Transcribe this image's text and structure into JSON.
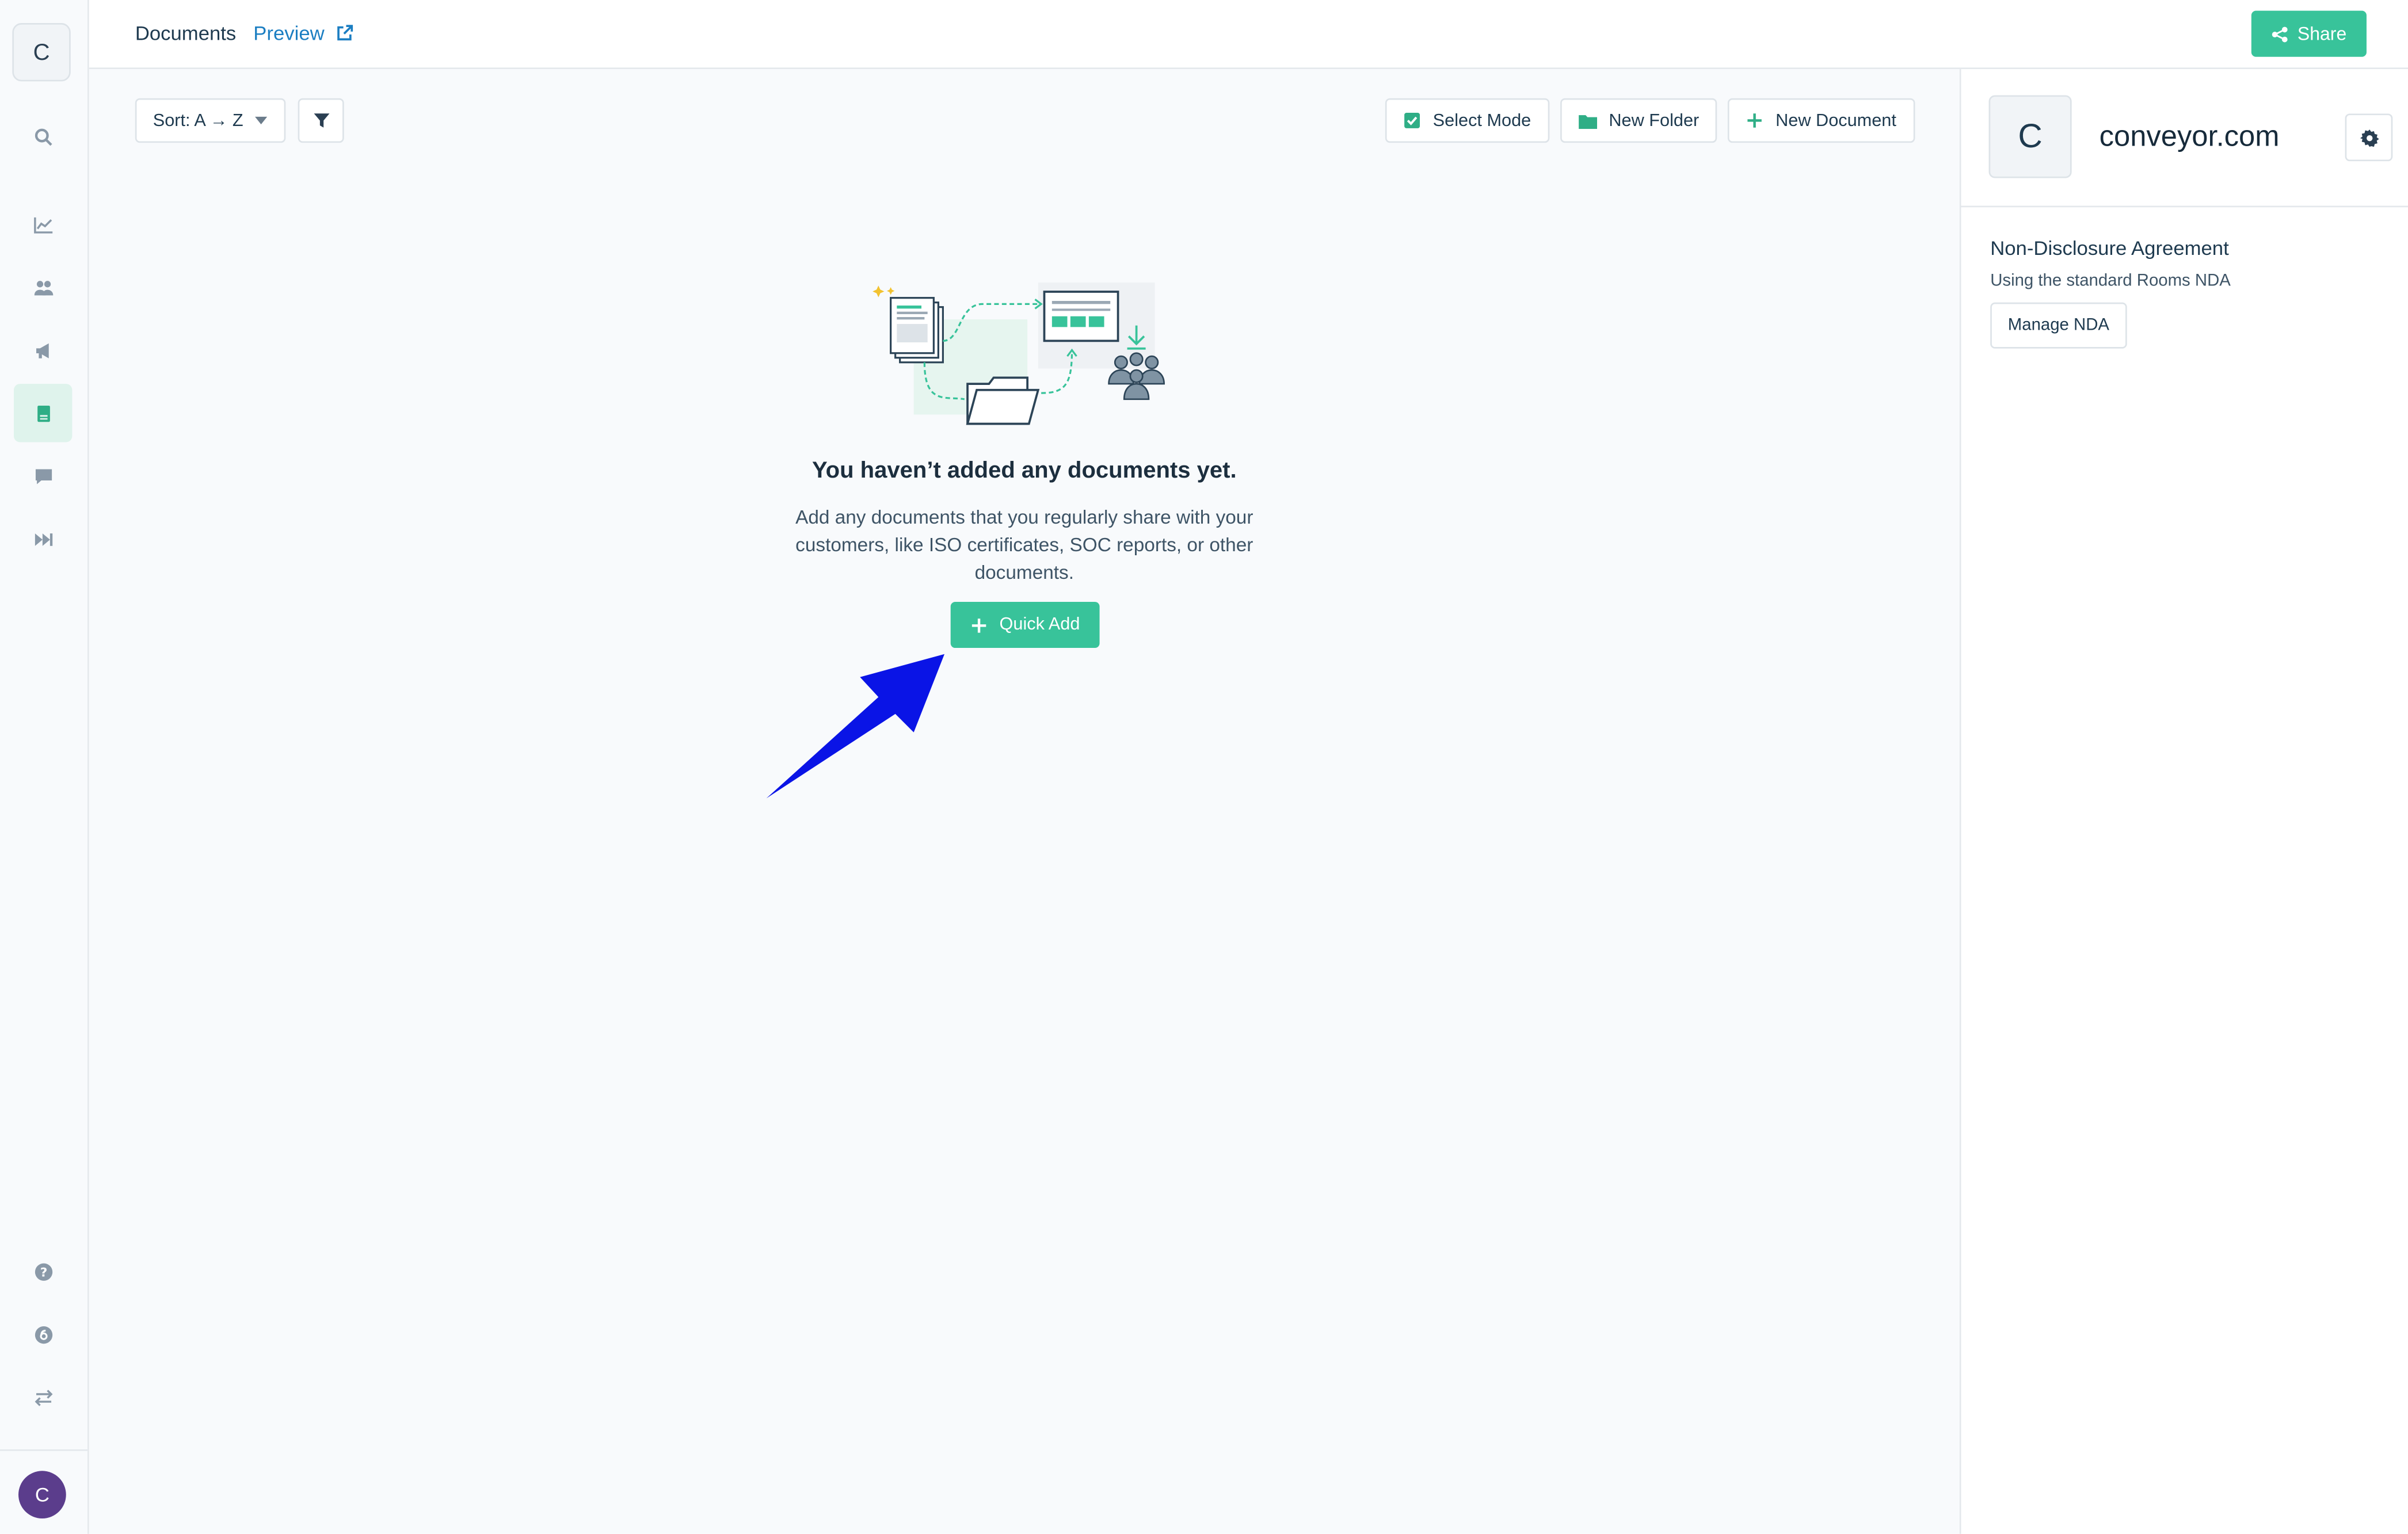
{
  "sidebar": {
    "logo_letter": "C",
    "avatar_letter": "C",
    "icons": [
      "search-icon",
      "analytics-icon",
      "users-icon",
      "megaphone-icon",
      "documents-icon",
      "chat-icon",
      "fast-forward-icon",
      "help-icon",
      "billing-icon",
      "switch-icon"
    ]
  },
  "header": {
    "title": "Documents",
    "preview_label": "Preview",
    "share_label": "Share"
  },
  "toolbar": {
    "sort_label": "Sort: A → Z",
    "select_mode_label": "Select Mode",
    "new_folder_label": "New Folder",
    "new_document_label": "New Document"
  },
  "empty_state": {
    "title": "You haven’t added any documents yet.",
    "description": "Add any documents that you regularly share with your customers, like ISO certificates, SOC reports, or other documents.",
    "quick_add_label": "Quick Add"
  },
  "org": {
    "logo_letter": "C",
    "name": "conveyor.com"
  },
  "nda": {
    "title": "Non-Disclosure Agreement",
    "subtitle": "Using the standard Rooms NDA",
    "manage_label": "Manage NDA"
  },
  "colors": {
    "accent": "#38c39a",
    "link": "#1b7ec2",
    "annotation_arrow": "#0a14e6",
    "avatar": "#5b3d8c"
  }
}
